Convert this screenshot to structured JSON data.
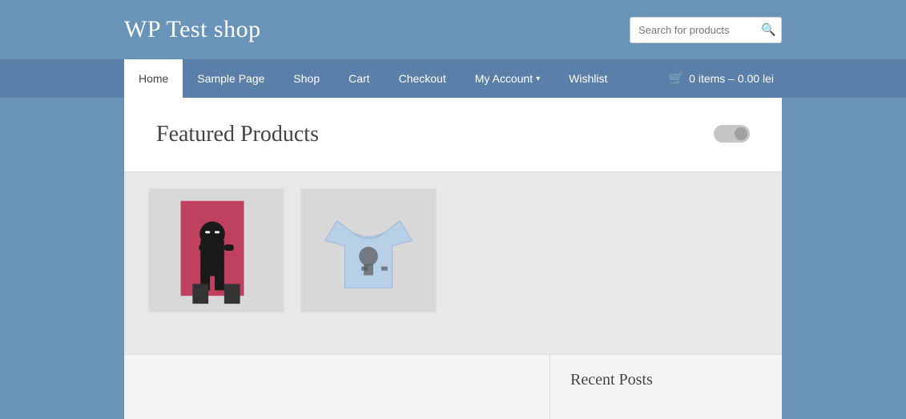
{
  "site": {
    "title": "WP Test shop"
  },
  "search": {
    "placeholder": "Search for products",
    "button_icon": "🔍"
  },
  "nav": {
    "items": [
      {
        "label": "Home",
        "active": true,
        "dropdown": false
      },
      {
        "label": "Sample Page",
        "active": false,
        "dropdown": false
      },
      {
        "label": "Shop",
        "active": false,
        "dropdown": false
      },
      {
        "label": "Cart",
        "active": false,
        "dropdown": false
      },
      {
        "label": "Checkout",
        "active": false,
        "dropdown": false
      },
      {
        "label": "My Account",
        "active": false,
        "dropdown": true
      },
      {
        "label": "Wishlist",
        "active": false,
        "dropdown": false
      }
    ],
    "cart": {
      "icon": "🛒",
      "label": "0 items – 0.00 lei"
    }
  },
  "featured": {
    "title": "Featured Products"
  },
  "products": [
    {
      "id": "product-1",
      "type": "ninja-poster",
      "alt": "Ninja poster product"
    },
    {
      "id": "product-2",
      "type": "tshirt",
      "alt": "T-shirt product"
    }
  ],
  "sidebar": {
    "recent_posts_title": "Recent Posts"
  }
}
